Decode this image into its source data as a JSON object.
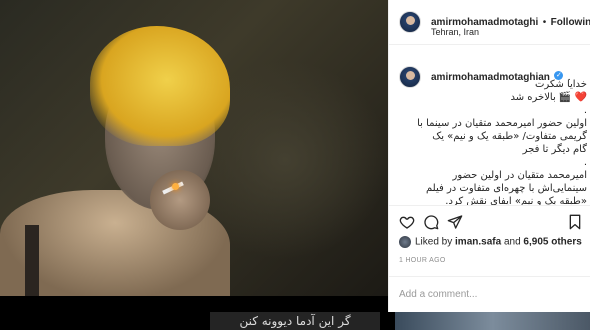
{
  "post": {
    "author": {
      "username": "amirmohamadmotaghi",
      "separator": "•",
      "follow_label": "Following",
      "location": "Tehran, Iran"
    },
    "caption_author": "amirmohamadmotaghian",
    "caption_author_suffix": ".",
    "caption_text": "خدایا شکرت\n❤️ 🎬 بالاخره شد\n.\nاولین حضور امیرمحمد متقیان در سینما با\nگریمی متفاوت/ «طبقه یک و نیم» یک\nگام دیگر تا فجر\n.\nامیرمحمد متقیان در اولین حضور\nسینمایی‌اش با چهره‌ای متفاوت در فیلم\n«طبقه یک و نیم» ایفای نقش کرد.",
    "actions": {
      "like_icon": "heart-icon",
      "comment_icon": "comment-icon",
      "share_icon": "share-icon",
      "save_icon": "bookmark-icon"
    },
    "likes": {
      "prefix": "Liked by ",
      "user": "iman.safa",
      "joiner": " and ",
      "others": "6,905 others"
    },
    "timestamp": "1 HOUR AGO",
    "comment_placeholder": "Add a comment..."
  },
  "media": {
    "subtitle_preview": "گر این آدما دیوونه کنن"
  },
  "colors": {
    "accent": "#3897f0",
    "text": "#262626",
    "muted": "#8e8e8e",
    "border": "#efefef"
  }
}
